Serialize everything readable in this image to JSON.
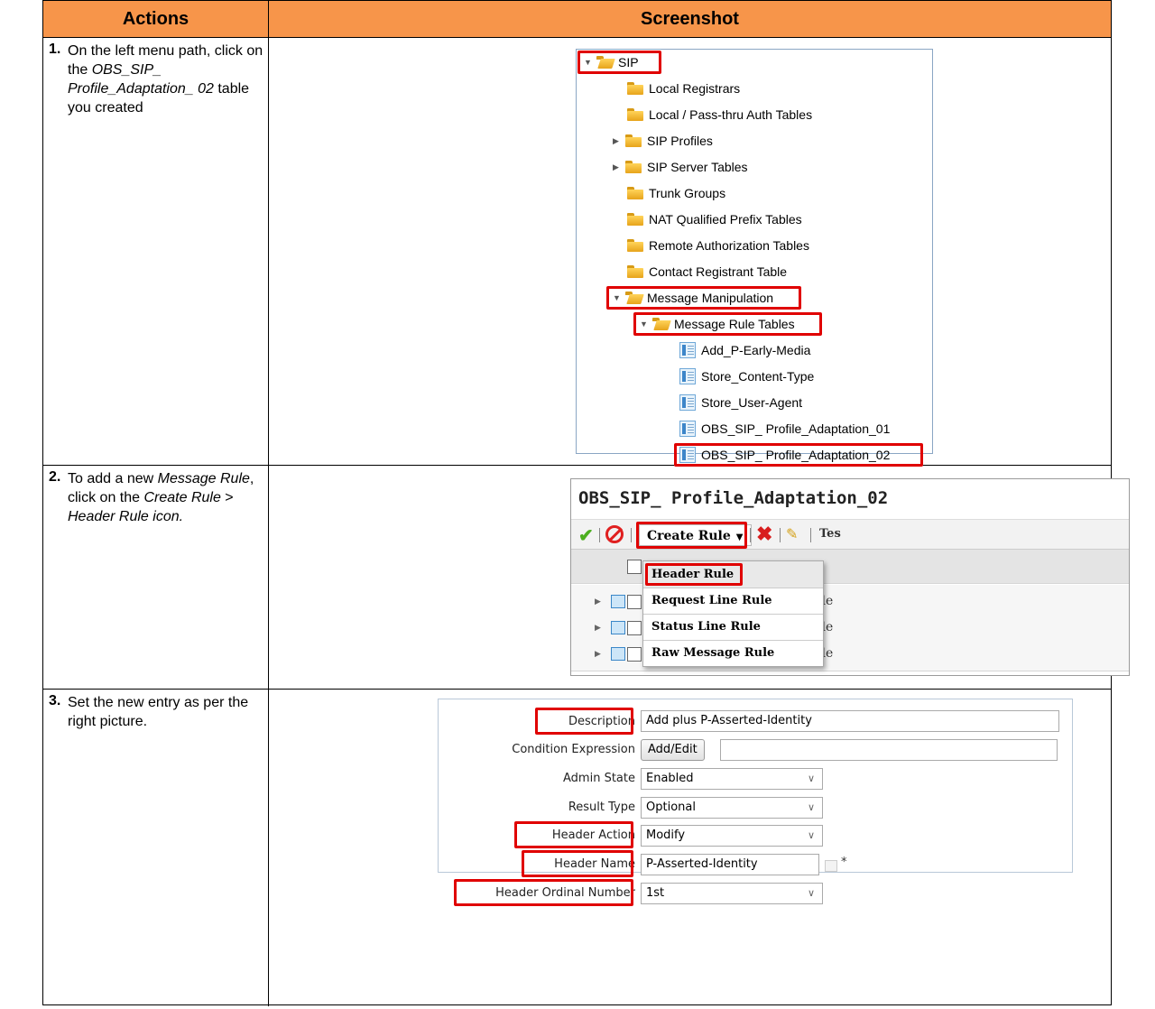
{
  "headers": {
    "actions": "Actions",
    "screenshot": "Screenshot"
  },
  "steps": [
    {
      "num": "1.",
      "pre": "On the left menu path, click on the ",
      "em": "OBS_SIP_ Profile_Adaptation_ 02",
      "post": " table you created"
    },
    {
      "num": "2.",
      "pre": "To add a new ",
      "em1": "Message Rule",
      "mid": ", click on the ",
      "em2": "Create Rule",
      "mid2": " > ",
      "em3": "Header Rule",
      "post": " icon."
    },
    {
      "num": "3.",
      "text": "Set the new entry as per the right picture."
    }
  ],
  "tree": {
    "items": [
      {
        "label": "SIP",
        "icon": "folder-open-icon",
        "expander": "expanded",
        "highlighted": true
      },
      {
        "label": "Local Registrars",
        "icon": "folder-icon"
      },
      {
        "label": "Local / Pass-thru Auth Tables",
        "icon": "folder-icon"
      },
      {
        "label": "SIP Profiles",
        "icon": "folder-icon",
        "expander": "collapsed"
      },
      {
        "label": "SIP Server Tables",
        "icon": "folder-icon",
        "expander": "collapsed"
      },
      {
        "label": "Trunk Groups",
        "icon": "folder-icon"
      },
      {
        "label": "NAT Qualified Prefix Tables",
        "icon": "folder-icon"
      },
      {
        "label": "Remote Authorization Tables",
        "icon": "folder-icon"
      },
      {
        "label": "Contact Registrant Table",
        "icon": "folder-icon"
      },
      {
        "label": "Message Manipulation",
        "icon": "folder-open-icon",
        "expander": "expanded",
        "highlighted": true
      },
      {
        "label": "Message Rule Tables",
        "icon": "folder-open-icon",
        "expander": "expanded",
        "highlighted": true
      },
      {
        "label": "Add_P-Early-Media",
        "icon": "table-icon"
      },
      {
        "label": "Store_Content-Type",
        "icon": "table-icon"
      },
      {
        "label": "Store_User-Agent",
        "icon": "table-icon"
      },
      {
        "label": "OBS_SIP_ Profile_Adaptation_01",
        "icon": "table-icon"
      },
      {
        "label": "OBS_SIP_ Profile_Adaptation_02",
        "icon": "table-icon",
        "highlighted": true
      }
    ]
  },
  "rule_table": {
    "title": "OBS_SIP_ Profile_Adaptation_02",
    "toolbar": {
      "create_rule": "Create Rule",
      "more": "Tes"
    },
    "menu": [
      "Header Rule",
      "Request Line Rule",
      "Status Line Rule",
      "Raw Message Rule"
    ],
    "header_tail": "e",
    "row_tails": [
      "Rule",
      "Rule",
      "Rule"
    ]
  },
  "form": {
    "description": {
      "label": "Description",
      "value": "Add plus P-Asserted-Identity"
    },
    "condition": {
      "label": "Condition Expression",
      "button": "Add/Edit",
      "value": ""
    },
    "admin_state": {
      "label": "Admin State",
      "value": "Enabled"
    },
    "result_type": {
      "label": "Result Type",
      "value": "Optional"
    },
    "header_action": {
      "label": "Header Action",
      "value": "Modify"
    },
    "header_name": {
      "label": "Header Name",
      "value": "P-Asserted-Identity",
      "required": "*"
    },
    "ordinal": {
      "label": "Header Ordinal Number",
      "value": "1st"
    }
  },
  "colors": {
    "header_bg": "#f7954a",
    "highlight": "#e00000"
  }
}
